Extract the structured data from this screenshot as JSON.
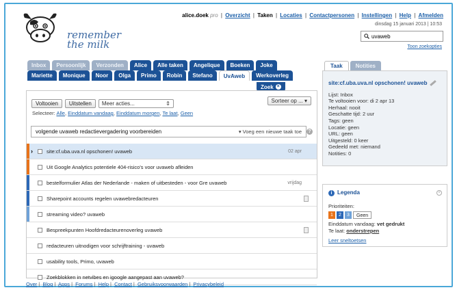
{
  "brand": {
    "line1": "remember",
    "line2": "the milk"
  },
  "topnav": {
    "user": "alice.doek",
    "pro": "pro",
    "items": [
      "Overzicht",
      "Taken",
      "Locaties",
      "Contactpersonen",
      "Instellingen",
      "Help",
      "Afmelden"
    ],
    "current": "Taken",
    "datetime": "dinsdag 15 januari 2013 | 10:53"
  },
  "search": {
    "value": "uvaweb",
    "options_link": "Toon zoekopties"
  },
  "list_tabs": {
    "row1": [
      "Inbox",
      "Persoonlijk",
      "Verzonden",
      "Alice",
      "Alle taken",
      "Angelique",
      "Boeken",
      "Joke"
    ],
    "row2": [
      "Mariette",
      "Monique",
      "Noor",
      "Olga",
      "Primo",
      "Robin",
      "Stefano",
      "UvAweb",
      "Werkoverleg"
    ],
    "active": "UvAweb",
    "search_tab": "Zoek"
  },
  "toolbar": {
    "complete": "Voltooien",
    "postpone": "Uitstellen",
    "more_actions": "Meer acties...",
    "sort": "Sorteer op ... ▾",
    "select_label": "Selecteer:",
    "select_links": [
      "Alle",
      "Einddatum vandaag",
      "Einddatum morgen",
      "Te laat",
      "Geen"
    ]
  },
  "add_task": {
    "value": "volgende uvaweb redactievergadering voorbereiden",
    "button": "▾ Voeg een nieuwe taak toe"
  },
  "tasks": [
    {
      "text": "site:cf.uba.uva.nl opschonen! uvaweb",
      "due": "02 apr",
      "priority_color": "#e8731a",
      "selected": true,
      "note": false
    },
    {
      "text": "Uit Google Analytics potentiele 404-risico's voor uvaweb afleiden",
      "due": "",
      "priority_color": "#e8731a",
      "selected": false,
      "note": false
    },
    {
      "text": "bestelformulier Atlas der Nederlande - maken of uitbesteden - voor Gre uvaweb",
      "due": "vrijdag",
      "priority_color": "#2c68b7",
      "selected": false,
      "note": false
    },
    {
      "text": "Sharepoint accounts regelen uvawebredacteuren",
      "due": "",
      "priority_color": "#2c68b7",
      "selected": false,
      "note": true
    },
    {
      "text": "streaming video? uvaweb",
      "due": "",
      "priority_color": "#6fa2d8",
      "selected": false,
      "note": false
    },
    {
      "text": "Bespreekpunten Hoofdredacteurenoverleg uvaweb",
      "due": "",
      "priority_color": "",
      "selected": false,
      "note": true
    },
    {
      "text": "redacteuren uitnodigen voor schrijftraining - uvaweb",
      "due": "",
      "priority_color": "",
      "selected": false,
      "note": false
    },
    {
      "text": "usability tools, Primo, uvaweb",
      "due": "",
      "priority_color": "",
      "selected": false,
      "note": false
    },
    {
      "text": "Zoekblokken in netvibes en igoogle aangepast aan uvaweb?",
      "due": "",
      "priority_color": "",
      "selected": false,
      "note": false
    }
  ],
  "footer": [
    "Over",
    "Blog",
    "Apps",
    "Forums",
    "Help",
    "Contact",
    "Gebruiksvoorwaarden",
    "Privacybeleid"
  ],
  "detail": {
    "tabs": [
      "Taak",
      "Notities"
    ],
    "title": "site:cf.uba.uva.nl opschonen! uvaweb",
    "lines": [
      "Lijst: Inbox",
      "Te voltooien voor: di 2 apr 13",
      "Herhaal: nooit",
      "Geschatte tijd: 2 uur",
      "Tags: geen",
      "Locatie: geen",
      "URL: geen",
      "Uitgesteld: 0 keer",
      "Gedeeld met: niemand",
      "Notities: 0"
    ]
  },
  "legend": {
    "title": "Legenda",
    "priorities_label": "Prioriteiten:",
    "priorities": [
      {
        "label": "1",
        "color": "#e8731a"
      },
      {
        "label": "2",
        "color": "#2c68b7"
      },
      {
        "label": "3",
        "color": "#6fa2d8"
      },
      {
        "label": "Geen",
        "color": ""
      }
    ],
    "due_today_label": "Einddatum vandaag:",
    "due_today_value": "vet gedrukt",
    "overdue_label": "Te laat:",
    "overdue_value": "onderstrepen",
    "shortcuts_link": "Leer sneltoetsen"
  }
}
